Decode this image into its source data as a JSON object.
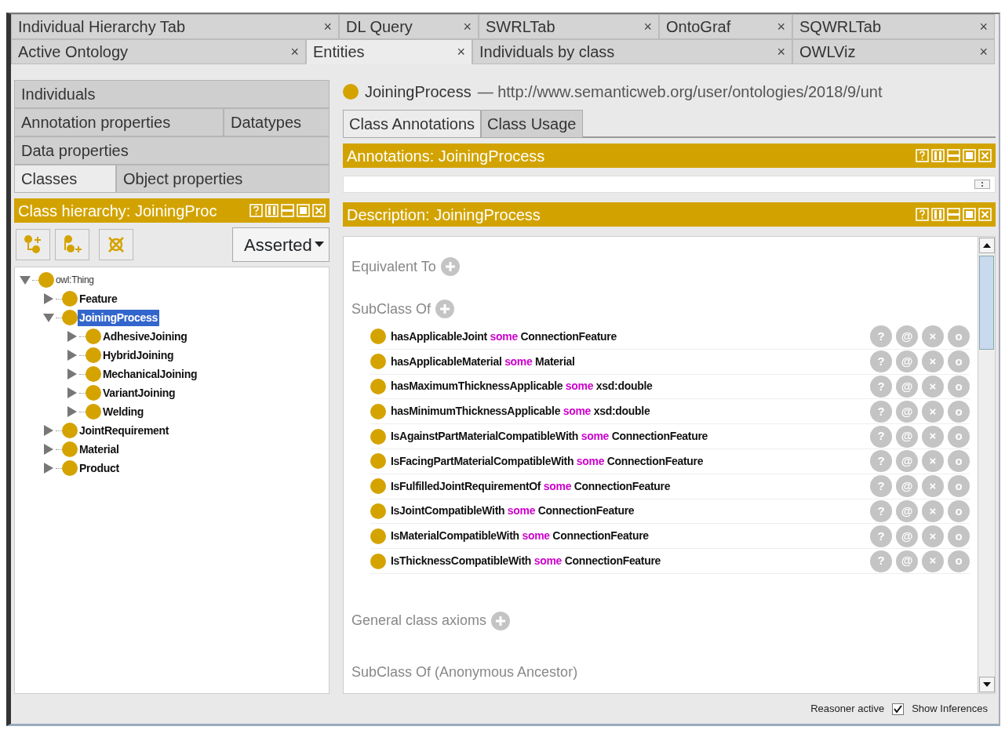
{
  "tab_rows": [
    [
      {
        "label": "Individual Hierarchy Tab",
        "selected": false,
        "close": "×"
      },
      {
        "label": "DL Query",
        "selected": false,
        "close": "×"
      },
      {
        "label": "SWRLTab",
        "selected": false,
        "close": "×"
      },
      {
        "label": "OntoGraf",
        "selected": false,
        "close": "×"
      },
      {
        "label": "SQWRLTab",
        "selected": false,
        "close": "×"
      }
    ],
    [
      {
        "label": "Active Ontology",
        "selected": false,
        "close": "×"
      },
      {
        "label": "Entities",
        "selected": true,
        "close": "×"
      },
      {
        "label": "Individuals by class",
        "selected": false,
        "close": "×"
      },
      {
        "label": "OWLViz",
        "selected": false,
        "close": "×"
      }
    ]
  ],
  "left": {
    "entity_tabs": [
      [
        {
          "label": "Individuals",
          "selected": false
        }
      ],
      [
        {
          "label": "Annotation properties",
          "selected": false
        },
        {
          "label": "Datatypes",
          "selected": false
        }
      ],
      [
        {
          "label": "Data properties",
          "selected": false
        }
      ],
      [
        {
          "label": "Classes",
          "selected": true
        },
        {
          "label": "Object properties",
          "selected": false
        }
      ]
    ],
    "hierarchy": {
      "title": "Class hierarchy: JoiningProc",
      "mode": "Asserted",
      "tree": [
        {
          "label": "owl:Thing",
          "expanded": true,
          "selected": false,
          "children": [
            {
              "label": "Feature",
              "expanded": false,
              "selected": false
            },
            {
              "label": "JoiningProcess",
              "expanded": true,
              "selected": true,
              "children": [
                {
                  "label": "AdhesiveJoining",
                  "expanded": false,
                  "selected": false
                },
                {
                  "label": "HybridJoining",
                  "expanded": false,
                  "selected": false
                },
                {
                  "label": "MechanicalJoining",
                  "expanded": false,
                  "selected": false
                },
                {
                  "label": "VariantJoining",
                  "expanded": false,
                  "selected": false
                },
                {
                  "label": "Welding",
                  "expanded": false,
                  "selected": false
                }
              ]
            },
            {
              "label": "JointRequirement",
              "expanded": false,
              "selected": false
            },
            {
              "label": "Material",
              "expanded": false,
              "selected": false
            },
            {
              "label": "Product",
              "expanded": false,
              "selected": false
            }
          ]
        }
      ]
    }
  },
  "right": {
    "entity": {
      "name": "JoiningProcess",
      "dash": "—",
      "iri": "http://www.semanticweb.org/user/ontologies/2018/9/unt"
    },
    "tabs": [
      {
        "label": "Class Annotations",
        "selected": true
      },
      {
        "label": "Class Usage",
        "selected": false
      }
    ],
    "annotations": {
      "title": "Annotations: JoiningProcess"
    },
    "description": {
      "title": "Description: JoiningProcess",
      "sections": [
        {
          "label": "Equivalent To",
          "addable": true
        },
        {
          "label": "SubClass Of",
          "addable": true,
          "axioms": [
            {
              "property": "hasApplicableJoint",
              "quantifier": "some",
              "filler": "ConnectionFeature",
              "actions": [
                "?",
                "@",
                "×",
                "o"
              ]
            },
            {
              "property": "hasApplicableMaterial",
              "quantifier": "some",
              "filler": "Material",
              "actions": [
                "?",
                "@",
                "×",
                "o"
              ]
            },
            {
              "property": "hasMaximumThicknessApplicable",
              "quantifier": "some",
              "filler": "xsd:double",
              "actions": [
                "?",
                "@",
                "×",
                "o"
              ]
            },
            {
              "property": "hasMinimumThicknessApplicable",
              "quantifier": "some",
              "filler": "xsd:double",
              "actions": [
                "?",
                "@",
                "×",
                "o"
              ]
            },
            {
              "property": "IsAgainstPartMaterialCompatibleWith",
              "quantifier": "some",
              "filler": "ConnectionFeature",
              "actions": [
                "?",
                "@",
                "×",
                "o"
              ]
            },
            {
              "property": "IsFacingPartMaterialCompatibleWith",
              "quantifier": "some",
              "filler": "ConnectionFeature",
              "actions": [
                "?",
                "@",
                "×",
                "o"
              ]
            },
            {
              "property": "IsFulfilledJointRequirementOf",
              "quantifier": "some",
              "filler": "ConnectionFeature",
              "actions": [
                "?",
                "@",
                "×",
                "o"
              ]
            },
            {
              "property": "IsJointCompatibleWith",
              "quantifier": "some",
              "filler": "ConnectionFeature",
              "actions": [
                "?",
                "@",
                "×",
                "o"
              ]
            },
            {
              "property": "IsMaterialCompatibleWith",
              "quantifier": "some",
              "filler": "ConnectionFeature",
              "actions": [
                "?",
                "@",
                "×",
                "o"
              ]
            },
            {
              "property": "IsThicknessCompatibleWith",
              "quantifier": "some",
              "filler": "ConnectionFeature",
              "actions": [
                "?",
                "@",
                "×",
                "o"
              ]
            }
          ]
        },
        {
          "label": "General class axioms",
          "addable": true
        },
        {
          "label": "SubClass Of (Anonymous Ancestor)",
          "addable": false
        }
      ]
    }
  },
  "status_bar": {
    "reasoner": "Reasoner active",
    "show_inferences": {
      "label": "Show Inferences",
      "checked": true
    }
  }
}
